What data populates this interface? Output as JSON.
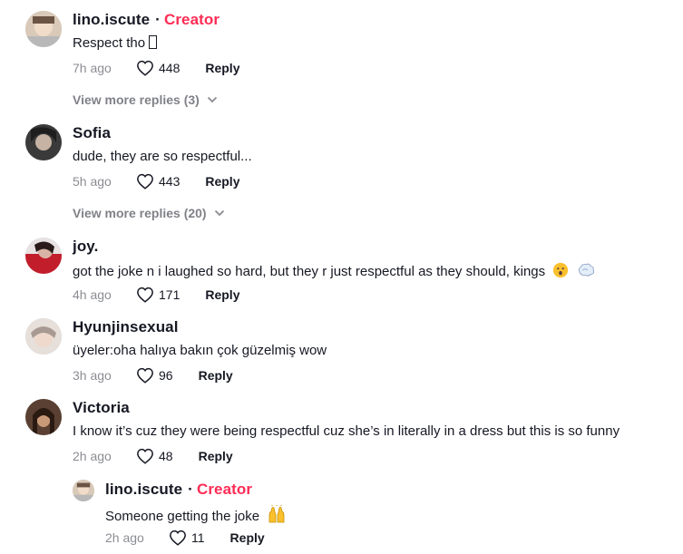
{
  "comments": [
    {
      "username": "lino.iscute",
      "badge": "Creator",
      "text": "Respect tho",
      "time": "7h ago",
      "likes": "448",
      "reply": "Reply",
      "view_more": "View more replies (3)"
    },
    {
      "username": "Sofia",
      "text": "dude, they are so respectful...",
      "time": "5h ago",
      "likes": "443",
      "reply": "Reply",
      "view_more": "View more replies (20)"
    },
    {
      "username": "joy.",
      "text": "got the joke n i laughed so hard, but they r just respectful as they should, kings",
      "emojis": [
        "hushed-face-emoji",
        "dash-emoji"
      ],
      "time": "4h ago",
      "likes": "171",
      "reply": "Reply"
    },
    {
      "username": "Hyunjinsexual",
      "text": "üyeler:oha halıya bakın çok güzelmiş wow",
      "time": "3h ago",
      "likes": "96",
      "reply": "Reply"
    },
    {
      "username": "Victoria",
      "text": "I know it’s cuz they were being respectful cuz she’s in literally in a dress but this is so funny",
      "time": "2h ago",
      "likes": "48",
      "reply": "Reply"
    }
  ],
  "nested_reply": {
    "username": "lino.iscute",
    "badge": "Creator",
    "text": "Someone getting the joke",
    "emojis": [
      "raising-hands-emoji"
    ],
    "time": "2h ago",
    "likes": "11",
    "reply": "Reply"
  },
  "colors": {
    "creator_badge": "#fe2c55",
    "text": "#161823",
    "muted": "#8a8b91"
  }
}
